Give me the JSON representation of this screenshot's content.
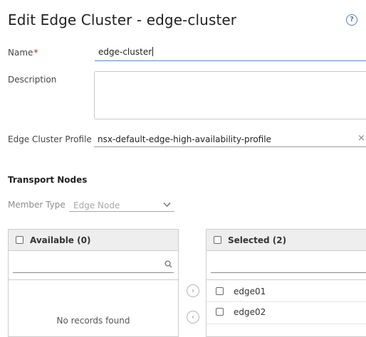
{
  "dialog": {
    "title": "Edit Edge Cluster - edge-cluster",
    "help_icon": "question-circle-icon",
    "help_glyph": "?"
  },
  "form": {
    "name_label": "Name",
    "required_marker": "*",
    "name_value": "edge-cluster",
    "description_label": "Description",
    "description_value": "",
    "profile_label": "Edge Cluster Profile",
    "profile_value": "nsx-default-edge-high-availability-profile",
    "profile_clear_glyph": "×"
  },
  "transport_nodes": {
    "section_title": "Transport Nodes",
    "member_type_label": "Member Type",
    "member_type_value": "Edge Node",
    "dropdown_icon": "chevron-down-icon"
  },
  "available": {
    "header": "Available (0)",
    "search_icon": "search-icon",
    "empty_text": "No records found"
  },
  "transfer": {
    "move_right_icon": "chevron-right-circle-icon",
    "move_left_icon": "chevron-left-circle-icon",
    "right_glyph": "›",
    "left_glyph": "‹"
  },
  "selected": {
    "header": "Selected (2)",
    "search_icon": "search-icon",
    "items": [
      "edge01",
      "edge02"
    ]
  }
}
